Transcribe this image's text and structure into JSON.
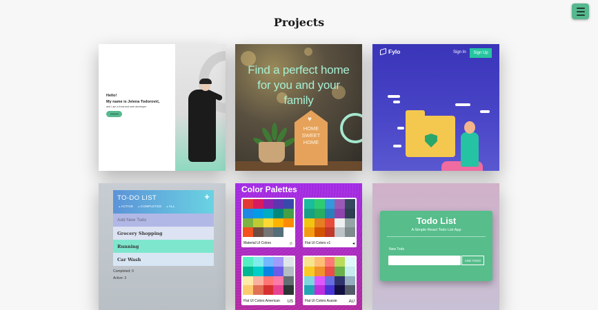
{
  "page": {
    "title": "Projects"
  },
  "menu": {
    "icon": "hamburger-menu-icon"
  },
  "projects": [
    {
      "id": "portfolio",
      "hello": "Hello!",
      "name_line": "My name is Jelena Todorović,",
      "sub_line": "and I am a front-end web developer"
    },
    {
      "id": "home",
      "headline_1": "Find a perfect home",
      "headline_2": "for you and your",
      "headline_3": "family",
      "sign_1": "HOME",
      "sign_2": "SWEET",
      "sign_3": "HOME"
    },
    {
      "id": "fylo",
      "logo": "Fylo",
      "sign_in": "Sign In",
      "sign_up": "Sign Up"
    },
    {
      "id": "todo",
      "title": "TO-DO LIST",
      "plus": "+",
      "filters": [
        "ACTIVE",
        "COMPLETED",
        "ALL"
      ],
      "placeholder": "Add New Todo",
      "items": [
        "Grocery Shopping",
        "Running",
        "Car Wash"
      ],
      "completed": "Completed: 0",
      "active": "Active: 3"
    },
    {
      "id": "palettes",
      "title": "Color Palettes",
      "palettes": [
        {
          "name": "Material UI Colors",
          "colors": [
            "#e53935",
            "#d81b60",
            "#8e24aa",
            "#5e35b1",
            "#3949ab",
            "#1e88e5",
            "#039be5",
            "#00acc1",
            "#00897b",
            "#43a047",
            "#7cb342",
            "#c0ca33",
            "#fdd835",
            "#ffb300",
            "#fb8c00",
            "#f4511e",
            "#6d4c41",
            "#757575",
            "#546e7a",
            "#ffffff"
          ]
        },
        {
          "name": "Flat UI Colors v1",
          "colors": [
            "#1abc9c",
            "#2ecc71",
            "#3498db",
            "#9b59b6",
            "#34495e",
            "#16a085",
            "#27ae60",
            "#2980b9",
            "#8e44ad",
            "#2c3e50",
            "#f1c40f",
            "#e67e22",
            "#e74c3c",
            "#ecf0f1",
            "#95a5a6",
            "#f39c12",
            "#d35400",
            "#c0392b",
            "#bdc3c7",
            "#7f8c8d"
          ]
        },
        {
          "name": "Flat UI Colors American",
          "colors": [
            "#55efc4",
            "#81ecec",
            "#74b9ff",
            "#a29bfe",
            "#dfe6e9",
            "#00b894",
            "#00cec9",
            "#0984e3",
            "#6c5ce7",
            "#b2bec3",
            "#ffeaa7",
            "#fab1a0",
            "#ff7675",
            "#fd79a8",
            "#636e72",
            "#fdcb6e",
            "#e17055",
            "#d63031",
            "#e84393",
            "#2d3436"
          ],
          "tag": "US"
        },
        {
          "name": "Flat UI Colors Aussie",
          "colors": [
            "#f6e58d",
            "#ffbe76",
            "#ff7979",
            "#badc58",
            "#dff9fb",
            "#f9ca24",
            "#f0932b",
            "#eb4d4b",
            "#6ab04c",
            "#c7ecee",
            "#7ed6df",
            "#e056fd",
            "#686de0",
            "#30336b",
            "#95afc0",
            "#22a6b3",
            "#be2edd",
            "#4834d4",
            "#130f40",
            "#535c68"
          ],
          "tag": "AU"
        }
      ]
    },
    {
      "id": "react-todo",
      "title": "Todo List",
      "subtitle": "A Simple React Todo List App",
      "label": "New Todo",
      "button": "ADD TODO"
    }
  ]
}
